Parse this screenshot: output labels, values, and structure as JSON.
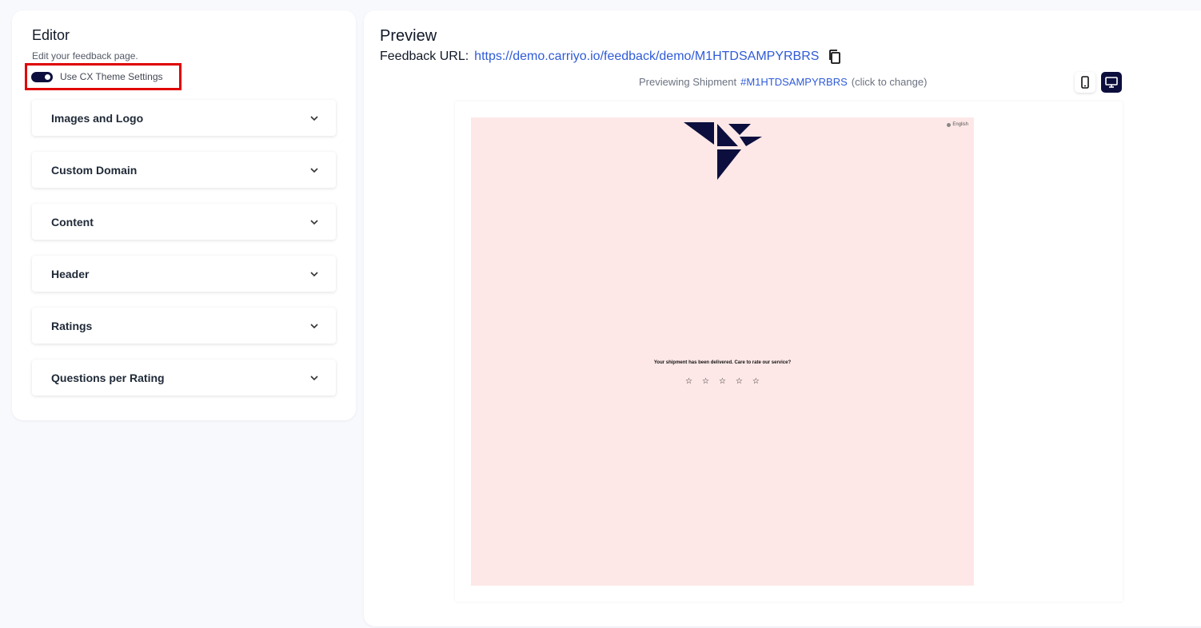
{
  "editor": {
    "title": "Editor",
    "subtitle": "Edit your feedback page.",
    "toggle_label": "Use CX Theme Settings",
    "toggle_on": true,
    "sections": [
      {
        "label": "Images and Logo"
      },
      {
        "label": "Custom Domain"
      },
      {
        "label": "Content"
      },
      {
        "label": "Header"
      },
      {
        "label": "Ratings"
      },
      {
        "label": "Questions per Rating"
      }
    ]
  },
  "preview": {
    "title": "Preview",
    "url_label": "Feedback URL:",
    "url": "https://demo.carriyo.io/feedback/demo/M1HTDSAMPYRBRS",
    "shipment_prefix": "Previewing Shipment",
    "shipment_id": "#M1HTDSAMPYRBRS",
    "shipment_hint": "(click to change)",
    "page": {
      "language": "English",
      "background": "#fde8e7",
      "prompt": "Your shipment has been delivered. Care to rate our service?",
      "stars": [
        "☆",
        "☆",
        "☆",
        "☆",
        "☆"
      ]
    }
  },
  "colors": {
    "accent": "#0c0f3d",
    "link": "#2f5bd8",
    "highlight_box": "#e00000"
  }
}
